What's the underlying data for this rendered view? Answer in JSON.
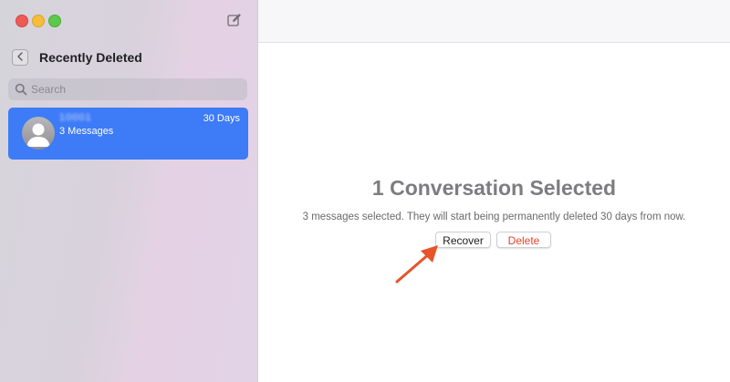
{
  "sidebar": {
    "title": "Recently Deleted",
    "search": {
      "placeholder": "Search"
    },
    "conversation": {
      "name": "10001",
      "days": "30 Days",
      "count": "3 Messages"
    }
  },
  "main": {
    "title": "1 Conversation Selected",
    "description": "3 messages selected. They will start being permanently deleted 30 days from now.",
    "recover_label": "Recover",
    "delete_label": "Delete"
  },
  "colors": {
    "accent": "#3d7bf7",
    "delete": "#e5432c",
    "annotation_arrow": "#e8532a"
  },
  "icons": [
    "compose-icon",
    "back-chevron-icon",
    "search-icon",
    "person-icon",
    "annotation-arrow-icon"
  ]
}
